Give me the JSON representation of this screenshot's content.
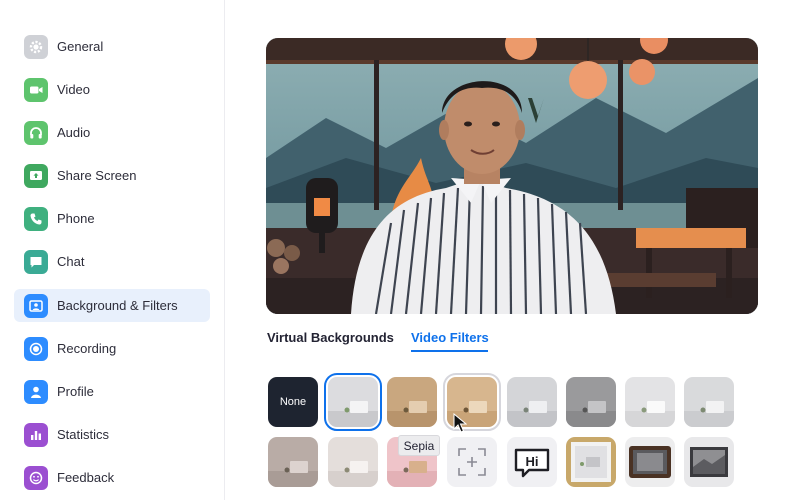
{
  "sidebar": {
    "items": [
      {
        "label": "General",
        "icon": "gear-icon",
        "color": "#cfd1d6"
      },
      {
        "label": "Video",
        "icon": "video-camera-icon",
        "color": "#5ec46d"
      },
      {
        "label": "Audio",
        "icon": "headphones-icon",
        "color": "#5ec46d"
      },
      {
        "label": "Share Screen",
        "icon": "share-screen-icon",
        "color": "#3fa85f"
      },
      {
        "label": "Phone",
        "icon": "phone-icon",
        "color": "#3fb07f"
      },
      {
        "label": "Chat",
        "icon": "chat-bubble-icon",
        "color": "#3aaa95"
      },
      {
        "label": "Background & Filters",
        "icon": "person-portrait-icon",
        "color": "#2d8cff"
      },
      {
        "label": "Recording",
        "icon": "record-icon",
        "color": "#2d8cff"
      },
      {
        "label": "Profile",
        "icon": "user-icon",
        "color": "#2d8cff"
      },
      {
        "label": "Statistics",
        "icon": "bar-chart-icon",
        "color": "#9b4fd1"
      },
      {
        "label": "Feedback",
        "icon": "smiley-icon",
        "color": "#9b4fd1"
      }
    ]
  },
  "tabs": {
    "virtual_backgrounds": "Virtual Backgrounds",
    "video_filters": "Video Filters"
  },
  "filters": {
    "none_label": "None",
    "tooltip": "Sepia",
    "speech_bubble_text": "Hi",
    "accent_color": "#0e71eb"
  }
}
